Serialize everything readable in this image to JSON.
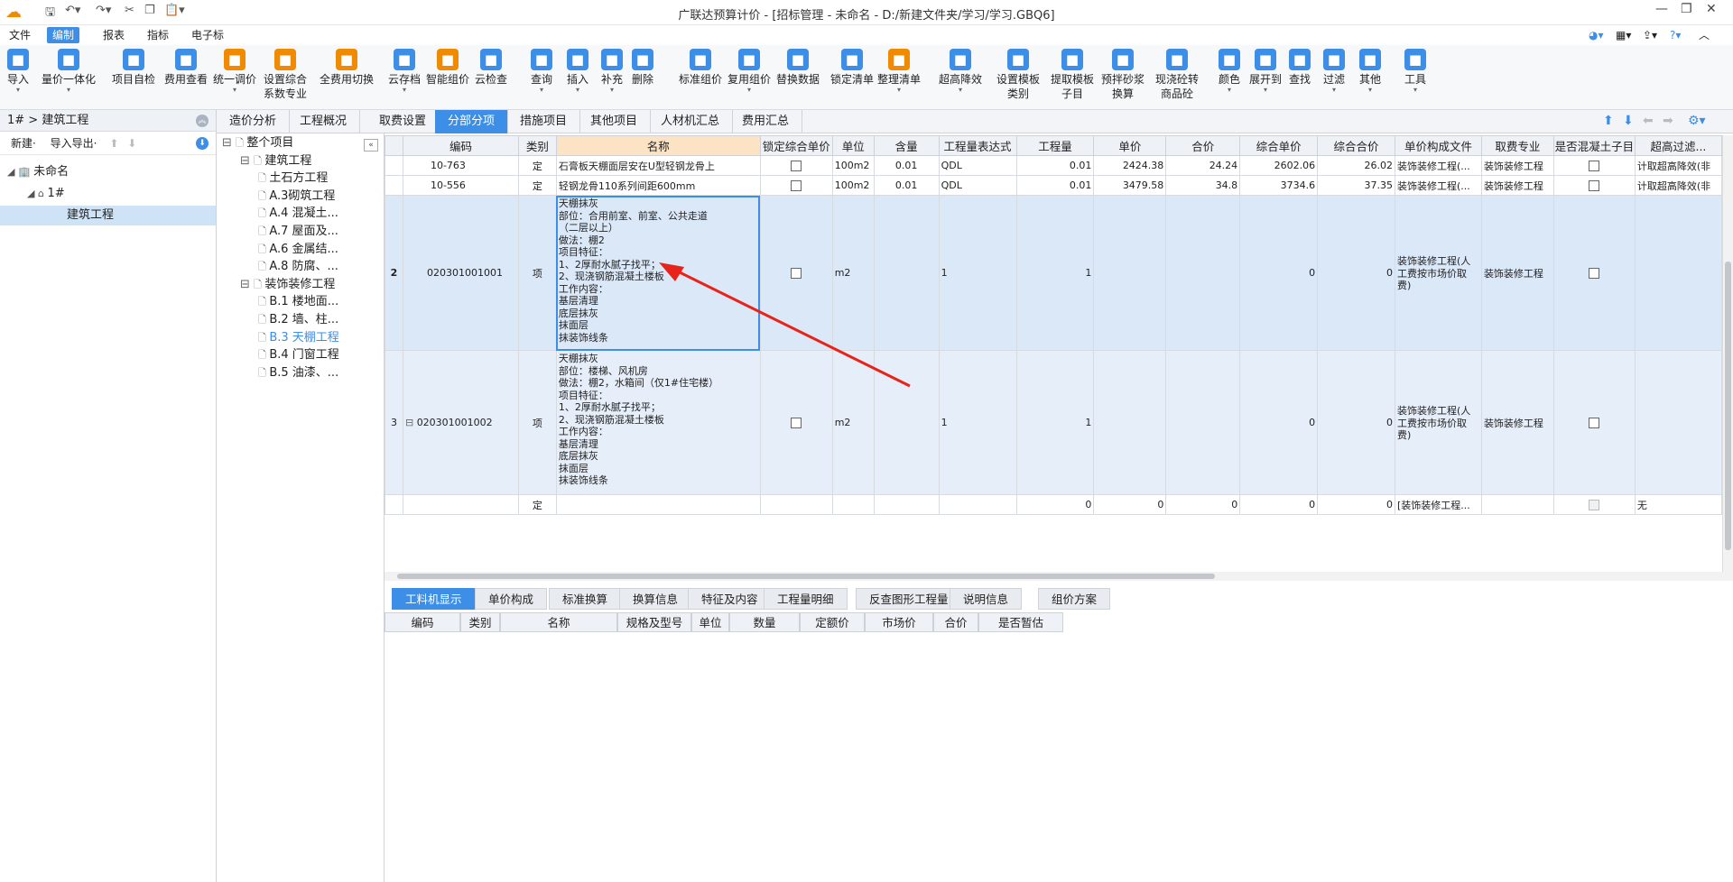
{
  "titlebar": {
    "title": "广联达预算计价 - [招标管理 - 未命名 - D:/新建文件夹/学习/学习.GBQ6]"
  },
  "menu": [
    "文件",
    "编制",
    "报表",
    "指标",
    "电子标"
  ],
  "ribbon": [
    {
      "label": "导入",
      "icon": "import-icon",
      "color": "#3c8ee6",
      "caret": true
    },
    {
      "label": "量价一体化",
      "icon": "qty-price-icon",
      "color": "#3c8ee6",
      "caret": true
    },
    {
      "label": "项目自检",
      "icon": "self-check-icon",
      "color": "#3c8ee6",
      "caret": false
    },
    {
      "label": "费用查看",
      "icon": "fee-view-icon",
      "color": "#3c8ee6",
      "caret": false
    },
    {
      "label": "统一调价",
      "icon": "adjust-price-icon",
      "color": "#f08a00",
      "caret": true
    },
    {
      "label": "设置综合\n系数专业",
      "icon": "coefficient-icon",
      "color": "#f08a00",
      "caret": false
    },
    {
      "label": "全费用切换",
      "icon": "full-cost-icon",
      "color": "#f08a00",
      "caret": false
    },
    {
      "label": "云存档",
      "icon": "cloud-save-icon",
      "color": "#3c8ee6",
      "caret": true
    },
    {
      "label": "智能组价",
      "icon": "smart-price-icon",
      "color": "#f08a00",
      "caret": false
    },
    {
      "label": "云检查",
      "icon": "cloud-check-icon",
      "color": "#3c8ee6",
      "caret": false
    },
    {
      "label": "查询",
      "icon": "query-icon",
      "color": "#3c8ee6",
      "caret": true
    },
    {
      "label": "插入",
      "icon": "insert-icon",
      "color": "#3c8ee6",
      "caret": true
    },
    {
      "label": "补充",
      "icon": "supplement-icon",
      "color": "#3c8ee6",
      "caret": true
    },
    {
      "label": "删除",
      "icon": "delete-icon",
      "color": "#3c8ee6",
      "caret": false
    },
    {
      "label": "标准组价",
      "icon": "standard-price-icon",
      "color": "#3c8ee6",
      "caret": false
    },
    {
      "label": "复用组价",
      "icon": "reuse-price-icon",
      "color": "#3c8ee6",
      "caret": true
    },
    {
      "label": "替换数据",
      "icon": "replace-data-icon",
      "color": "#3c8ee6",
      "caret": false
    },
    {
      "label": "锁定清单",
      "icon": "lock-icon",
      "color": "#3c8ee6",
      "caret": false
    },
    {
      "label": "整理清单",
      "icon": "organize-list-icon",
      "color": "#f08a00",
      "caret": true
    },
    {
      "label": "超高降效",
      "icon": "high-rise-icon",
      "color": "#3c8ee6",
      "caret": true
    },
    {
      "label": "设置模板\n类别",
      "icon": "template-type-icon",
      "color": "#3c8ee6",
      "caret": false
    },
    {
      "label": "提取模板\n子目",
      "icon": "template-extract-icon",
      "color": "#3c8ee6",
      "caret": false
    },
    {
      "label": "预拌砂浆\n换算",
      "icon": "mortar-icon",
      "color": "#3c8ee6",
      "caret": false
    },
    {
      "label": "现浇砼转\n商品砼",
      "icon": "concrete-icon",
      "color": "#3c8ee6",
      "caret": false
    },
    {
      "label": "颜色",
      "icon": "color-icon",
      "color": "#3c8ee6",
      "caret": true
    },
    {
      "label": "展开到",
      "icon": "expand-icon",
      "color": "#3c8ee6",
      "caret": true
    },
    {
      "label": "查找",
      "icon": "find-icon",
      "color": "#3c8ee6",
      "caret": false
    },
    {
      "label": "过滤",
      "icon": "filter-icon",
      "color": "#3c8ee6",
      "caret": true
    },
    {
      "label": "其他",
      "icon": "other-icon",
      "color": "#3c8ee6",
      "caret": true
    },
    {
      "label": "工具",
      "icon": "tools-icon",
      "color": "#3c8ee6",
      "caret": true
    }
  ],
  "left_panel": {
    "breadcrumb": "1# > 建筑工程",
    "new_label": "新建·",
    "import_export_label": "导入导出·",
    "tree": [
      {
        "label": "未命名",
        "level": 0
      },
      {
        "label": "1#",
        "level": 1
      },
      {
        "label": "建筑工程",
        "level": 2,
        "selected": true
      }
    ]
  },
  "tabs": [
    "造价分析",
    "工程概况",
    "取费设置",
    "分部分项",
    "措施项目",
    "其他项目",
    "人材机汇总",
    "费用汇总"
  ],
  "active_tab": "分部分项",
  "mid_tree": [
    {
      "label": "整个项目",
      "level": 0
    },
    {
      "label": "建筑工程",
      "level": 1
    },
    {
      "label": "土石方工程",
      "level": 2
    },
    {
      "label": "A.3砌筑工程",
      "level": 2
    },
    {
      "label": "A.4  混凝土...",
      "level": 2
    },
    {
      "label": "A.7  屋面及...",
      "level": 2
    },
    {
      "label": "A.6  金属结...",
      "level": 2
    },
    {
      "label": "A.8  防腐、...",
      "level": 2
    },
    {
      "label": "装饰装修工程",
      "level": 1
    },
    {
      "label": "B.1  楼地面...",
      "level": 2
    },
    {
      "label": "B.2  墙、柱...",
      "level": 2
    },
    {
      "label": "B.3  天棚工程",
      "level": 2,
      "selected": true
    },
    {
      "label": "B.4  门窗工程",
      "level": 2
    },
    {
      "label": "B.5  油漆、...",
      "level": 2
    }
  ],
  "grid": {
    "headers": [
      "",
      "编码",
      "类别",
      "名称",
      "锁定综合单价",
      "单位",
      "含量",
      "工程量表达式",
      "工程量",
      "单价",
      "合价",
      "综合单价",
      "综合合价",
      "单价构成文件",
      "取费专业",
      "是否混凝土子目",
      "超高过滤..."
    ],
    "rows": [
      {
        "no": "",
        "code": "10-763",
        "type": "定",
        "name": "石膏板天棚面层安在U型轻钢龙骨上",
        "unit": "100m2",
        "content": "0.01",
        "expr": "QDL",
        "qty": "0.01",
        "price": "2424.38",
        "total": "24.24",
        "comp_price": "2602.06",
        "comp_total": "26.02",
        "fee_file": "装饰装修工程(...",
        "fee_major": "装饰装修工程",
        "filter": "计取超高降效(非"
      },
      {
        "no": "",
        "code": "10-556",
        "type": "定",
        "name": "轻钢龙骨110系列间距600mm",
        "unit": "100m2",
        "content": "0.01",
        "expr": "QDL",
        "qty": "0.01",
        "price": "3479.58",
        "total": "34.8",
        "comp_price": "3734.6",
        "comp_total": "37.35",
        "fee_file": "装饰装修工程(...",
        "fee_major": "装饰装修工程",
        "filter": "计取超高降效(非"
      },
      {
        "no": "2",
        "code": "020301001001",
        "type": "项",
        "name": "天棚抹灰\n部位：合用前室、前室、公共走道\n（二层以上）\n做法：棚2\n项目特征：\n1、2厚耐水腻子找平；\n2、现浇钢筋混凝土楼板\n工作内容：\n基层清理\n底层抹灰\n抹面层\n抹装饰线条",
        "unit": "m2",
        "content": "",
        "expr": "1",
        "qty": "1",
        "price": "",
        "total": "",
        "comp_price": "0",
        "comp_total": "0",
        "fee_file": "装饰装修工程(人\n工费按市场价取\n费)",
        "fee_major": "装饰装修工程",
        "filter": ""
      },
      {
        "no": "3",
        "code": "020301001002",
        "type": "项",
        "name": "天棚抹灰\n部位：楼梯、风机房\n做法：棚2，水箱间（仅1#住宅楼）\n项目特征：\n1、2厚耐水腻子找平；\n2、现浇钢筋混凝土楼板\n工作内容：\n基层清理\n底层抹灰\n抹面层\n抹装饰线条",
        "unit": "m2",
        "content": "",
        "expr": "1",
        "qty": "1",
        "price": "",
        "total": "",
        "comp_price": "0",
        "comp_total": "0",
        "fee_file": "装饰装修工程(人\n工费按市场价取\n费)",
        "fee_major": "装饰装修工程",
        "filter": ""
      },
      {
        "no": "",
        "code": "",
        "type": "定",
        "name": "",
        "unit": "",
        "content": "",
        "expr": "",
        "qty": "0",
        "price": "0",
        "total": "0",
        "comp_price": "0",
        "comp_total": "0",
        "fee_file": "[装饰装修工程...",
        "fee_major": "",
        "filter": "无"
      }
    ]
  },
  "bottom_tabs": [
    "工料机显示",
    "单价构成",
    "标准换算",
    "换算信息",
    "特征及内容",
    "工程量明细",
    "反查图形工程量",
    "说明信息",
    "组价方案"
  ],
  "bottom_headers": [
    "编码",
    "类别",
    "名称",
    "规格及型号",
    "单位",
    "数量",
    "定额价",
    "市场价",
    "合价",
    "是否暂估"
  ]
}
